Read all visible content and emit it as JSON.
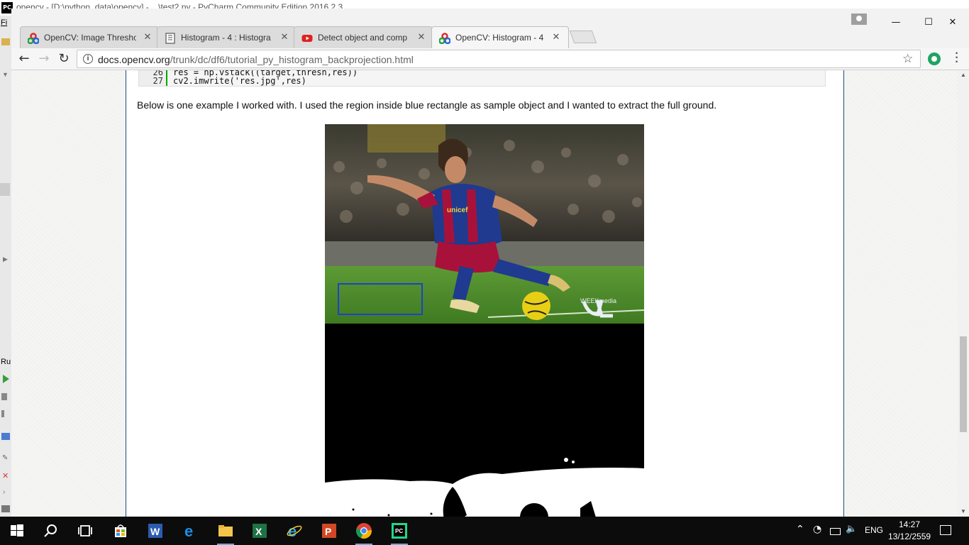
{
  "pycharm": {
    "title": "opencv - [D:\\python_data\\opencv] - ...\\test2.py - PyCharm Community Edition 2016.2.3",
    "logo": "PC",
    "menu_stub": "Fi",
    "run_stub": "Ru"
  },
  "browser": {
    "tabs": [
      {
        "title": "OpenCV: Image Thresho",
        "favicon": "opencv-logo-icon",
        "active": false
      },
      {
        "title": "Histogram - 4 : Histogra",
        "favicon": "page-icon",
        "active": false
      },
      {
        "title": "Detect object and comp",
        "favicon": "youtube-icon",
        "active": false
      },
      {
        "title": "OpenCV: Histogram - 4 :",
        "favicon": "opencv-logo-icon",
        "active": true
      }
    ],
    "url_host": "docs.opencv.org",
    "url_path": "/trunk/dc/df6/tutorial_py_histogram_backprojection.html",
    "window_controls": {
      "minimize": "—",
      "maximize": "☐",
      "close": "✕"
    }
  },
  "page": {
    "code_lines": [
      {
        "num": "26",
        "text": "res = np.vstack((target,thresh,res))"
      },
      {
        "num": "27",
        "text": "cv2.imwrite('res.jpg',res)"
      }
    ],
    "paragraph": "Below is one example I worked with. I used the region inside blue rectangle as sample object and I wanted to extract the full ground.",
    "jersey_text": "unicef",
    "watermark": "WEEKmedia"
  },
  "taskbar": {
    "apps": [
      "start-icon",
      "search-icon",
      "task-view-icon",
      "store-icon",
      "word-icon",
      "edge-icon",
      "file-explorer-icon",
      "excel-icon",
      "internet-explorer-icon",
      "powerpoint-icon",
      "chrome-icon",
      "pycharm-icon"
    ],
    "language": "ENG",
    "time": "14:27",
    "date": "13/12/2559"
  },
  "colors": {
    "accent_blue": "#1d43c8",
    "page_border": "#1a4e7a",
    "taskbar": "#0c0c0c",
    "pitch_green": "#4f8a2a"
  }
}
